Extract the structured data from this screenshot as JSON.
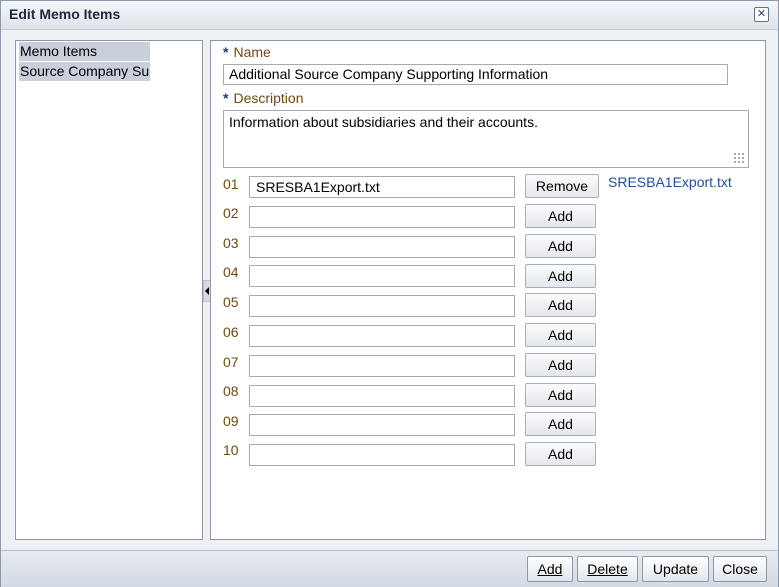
{
  "window": {
    "title": "Edit Memo Items",
    "close_icon": "close-icon"
  },
  "left_panel": {
    "items": [
      {
        "label": "Memo Items"
      },
      {
        "label": "Source Company Sup"
      }
    ]
  },
  "form": {
    "name_label": "Name",
    "name_value": "Additional Source Company Supporting Information",
    "description_label": "Description",
    "description_value": "Information about subsidiaries and their accounts.",
    "required_marker": "*",
    "attachments": [
      {
        "num": "01",
        "file": "SRESBA1Export.txt",
        "action": "Remove",
        "link": "SRESBA1Export.txt"
      },
      {
        "num": "02",
        "file": "",
        "action": "Add"
      },
      {
        "num": "03",
        "file": "",
        "action": "Add"
      },
      {
        "num": "04",
        "file": "",
        "action": "Add"
      },
      {
        "num": "05",
        "file": "",
        "action": "Add"
      },
      {
        "num": "06",
        "file": "",
        "action": "Add"
      },
      {
        "num": "07",
        "file": "",
        "action": "Add"
      },
      {
        "num": "08",
        "file": "",
        "action": "Add"
      },
      {
        "num": "09",
        "file": "",
        "action": "Add"
      },
      {
        "num": "10",
        "file": "",
        "action": "Add"
      }
    ]
  },
  "footer": {
    "add_label": "Add",
    "delete_label": "Delete",
    "update_label": "Update",
    "close_label": "Close"
  }
}
